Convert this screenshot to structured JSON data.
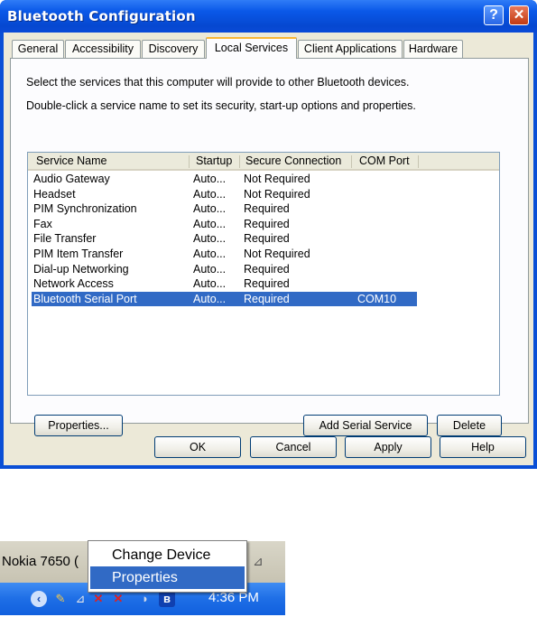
{
  "window": {
    "title": "Bluetooth Configuration"
  },
  "tabs": [
    "General",
    "Accessibility",
    "Discovery",
    "Local Services",
    "Client Applications",
    "Hardware"
  ],
  "active_tab": "Local Services",
  "description": {
    "line1": "Select the services that this computer will provide to other Bluetooth devices.",
    "line2": "Double-click a service name to set its security, start-up options and properties."
  },
  "services_table": {
    "columns": [
      "Service Name",
      "Startup",
      "Secure Connection",
      "COM Port"
    ],
    "rows": [
      {
        "name": "Audio Gateway",
        "startup": "Auto...",
        "secure": "Not Required",
        "com": ""
      },
      {
        "name": "Headset",
        "startup": "Auto...",
        "secure": "Not Required",
        "com": ""
      },
      {
        "name": "PIM Synchronization",
        "startup": "Auto...",
        "secure": "Required",
        "com": ""
      },
      {
        "name": "Fax",
        "startup": "Auto...",
        "secure": "Required",
        "com": ""
      },
      {
        "name": "File Transfer",
        "startup": "Auto...",
        "secure": "Required",
        "com": ""
      },
      {
        "name": "PIM Item Transfer",
        "startup": "Auto...",
        "secure": "Not Required",
        "com": ""
      },
      {
        "name": "Dial-up Networking",
        "startup": "Auto...",
        "secure": "Required",
        "com": ""
      },
      {
        "name": "Network Access",
        "startup": "Auto...",
        "secure": "Required",
        "com": ""
      },
      {
        "name": "Bluetooth Serial Port",
        "startup": "Auto...",
        "secure": "Required",
        "com": "COM10"
      }
    ],
    "selected_row": "Bluetooth Serial Port"
  },
  "panel_buttons": {
    "properties": "Properties...",
    "add_serial": "Add Serial Service",
    "delete": "Delete"
  },
  "dialog_buttons": {
    "ok": "OK",
    "cancel": "Cancel",
    "apply": "Apply",
    "help": "Help"
  },
  "taskbar": {
    "item_label": "Nokia 7650 (",
    "clock": "4:36 PM"
  },
  "context_menu": {
    "items": [
      "Change Device",
      "Properties"
    ],
    "highlighted": "Properties"
  },
  "colors": {
    "title_bar": "#0a58e8",
    "selection": "#316ac5",
    "dialog_face": "#ece9d8",
    "tab_highlight": "#f8b636"
  }
}
